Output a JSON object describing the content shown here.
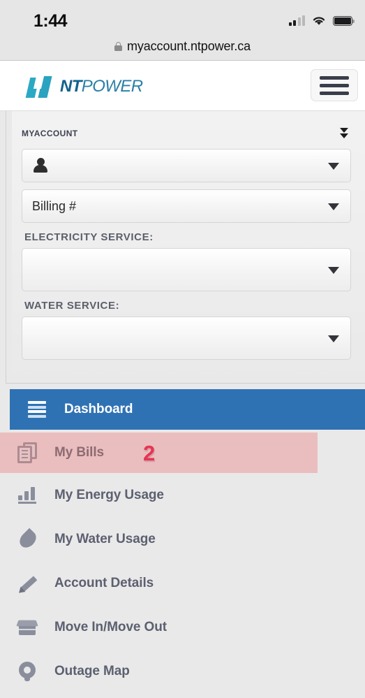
{
  "status_bar": {
    "time": "1:44",
    "signal_icon": "cellular-signal-icon",
    "wifi_icon": "wifi-icon",
    "battery_icon": "battery-full-icon"
  },
  "browser": {
    "lock_icon": "lock-icon",
    "url": "myaccount.ntpower.ca"
  },
  "brand": {
    "logo_mark": "nt-power-logo-mark",
    "name_bold": "NT",
    "name_light": "POWER",
    "menu_icon": "hamburger-menu-icon"
  },
  "account_panel": {
    "title": "MyAccount",
    "collapse_icon": "double-chevron-down-icon",
    "account_select": {
      "icon": "user-icon",
      "value": "",
      "caret_icon": "caret-down-icon"
    },
    "billing_select": {
      "value": "Billing #",
      "caret_icon": "caret-down-icon"
    },
    "electricity_label": "ELECTRICITY SERVICE:",
    "electricity_select": {
      "value": "",
      "caret_icon": "caret-down-icon"
    },
    "water_label": "WATER SERVICE:",
    "water_select": {
      "value": "",
      "caret_icon": "caret-down-icon"
    }
  },
  "nav": {
    "items": [
      {
        "label": "Dashboard",
        "icon": "dashboard-list-icon",
        "state": "active"
      },
      {
        "label": "My Bills",
        "icon": "documents-icon",
        "state": "highlight",
        "marker": "2"
      },
      {
        "label": "My Energy Usage",
        "icon": "bar-chart-icon",
        "state": "normal"
      },
      {
        "label": "My Water Usage",
        "icon": "water-drop-icon",
        "state": "normal"
      },
      {
        "label": "Account Details",
        "icon": "pencil-icon",
        "state": "normal"
      },
      {
        "label": "Move In/Move Out",
        "icon": "box-icon",
        "state": "normal"
      },
      {
        "label": "Outage Map",
        "icon": "map-pin-icon",
        "state": "normal"
      }
    ]
  },
  "colors": {
    "active_blue": "#2f72b4",
    "highlight_pink": "#eabebe",
    "marker_red": "#e63455",
    "logo_teal": "#2ba9c4",
    "logo_navy": "#12628c"
  }
}
